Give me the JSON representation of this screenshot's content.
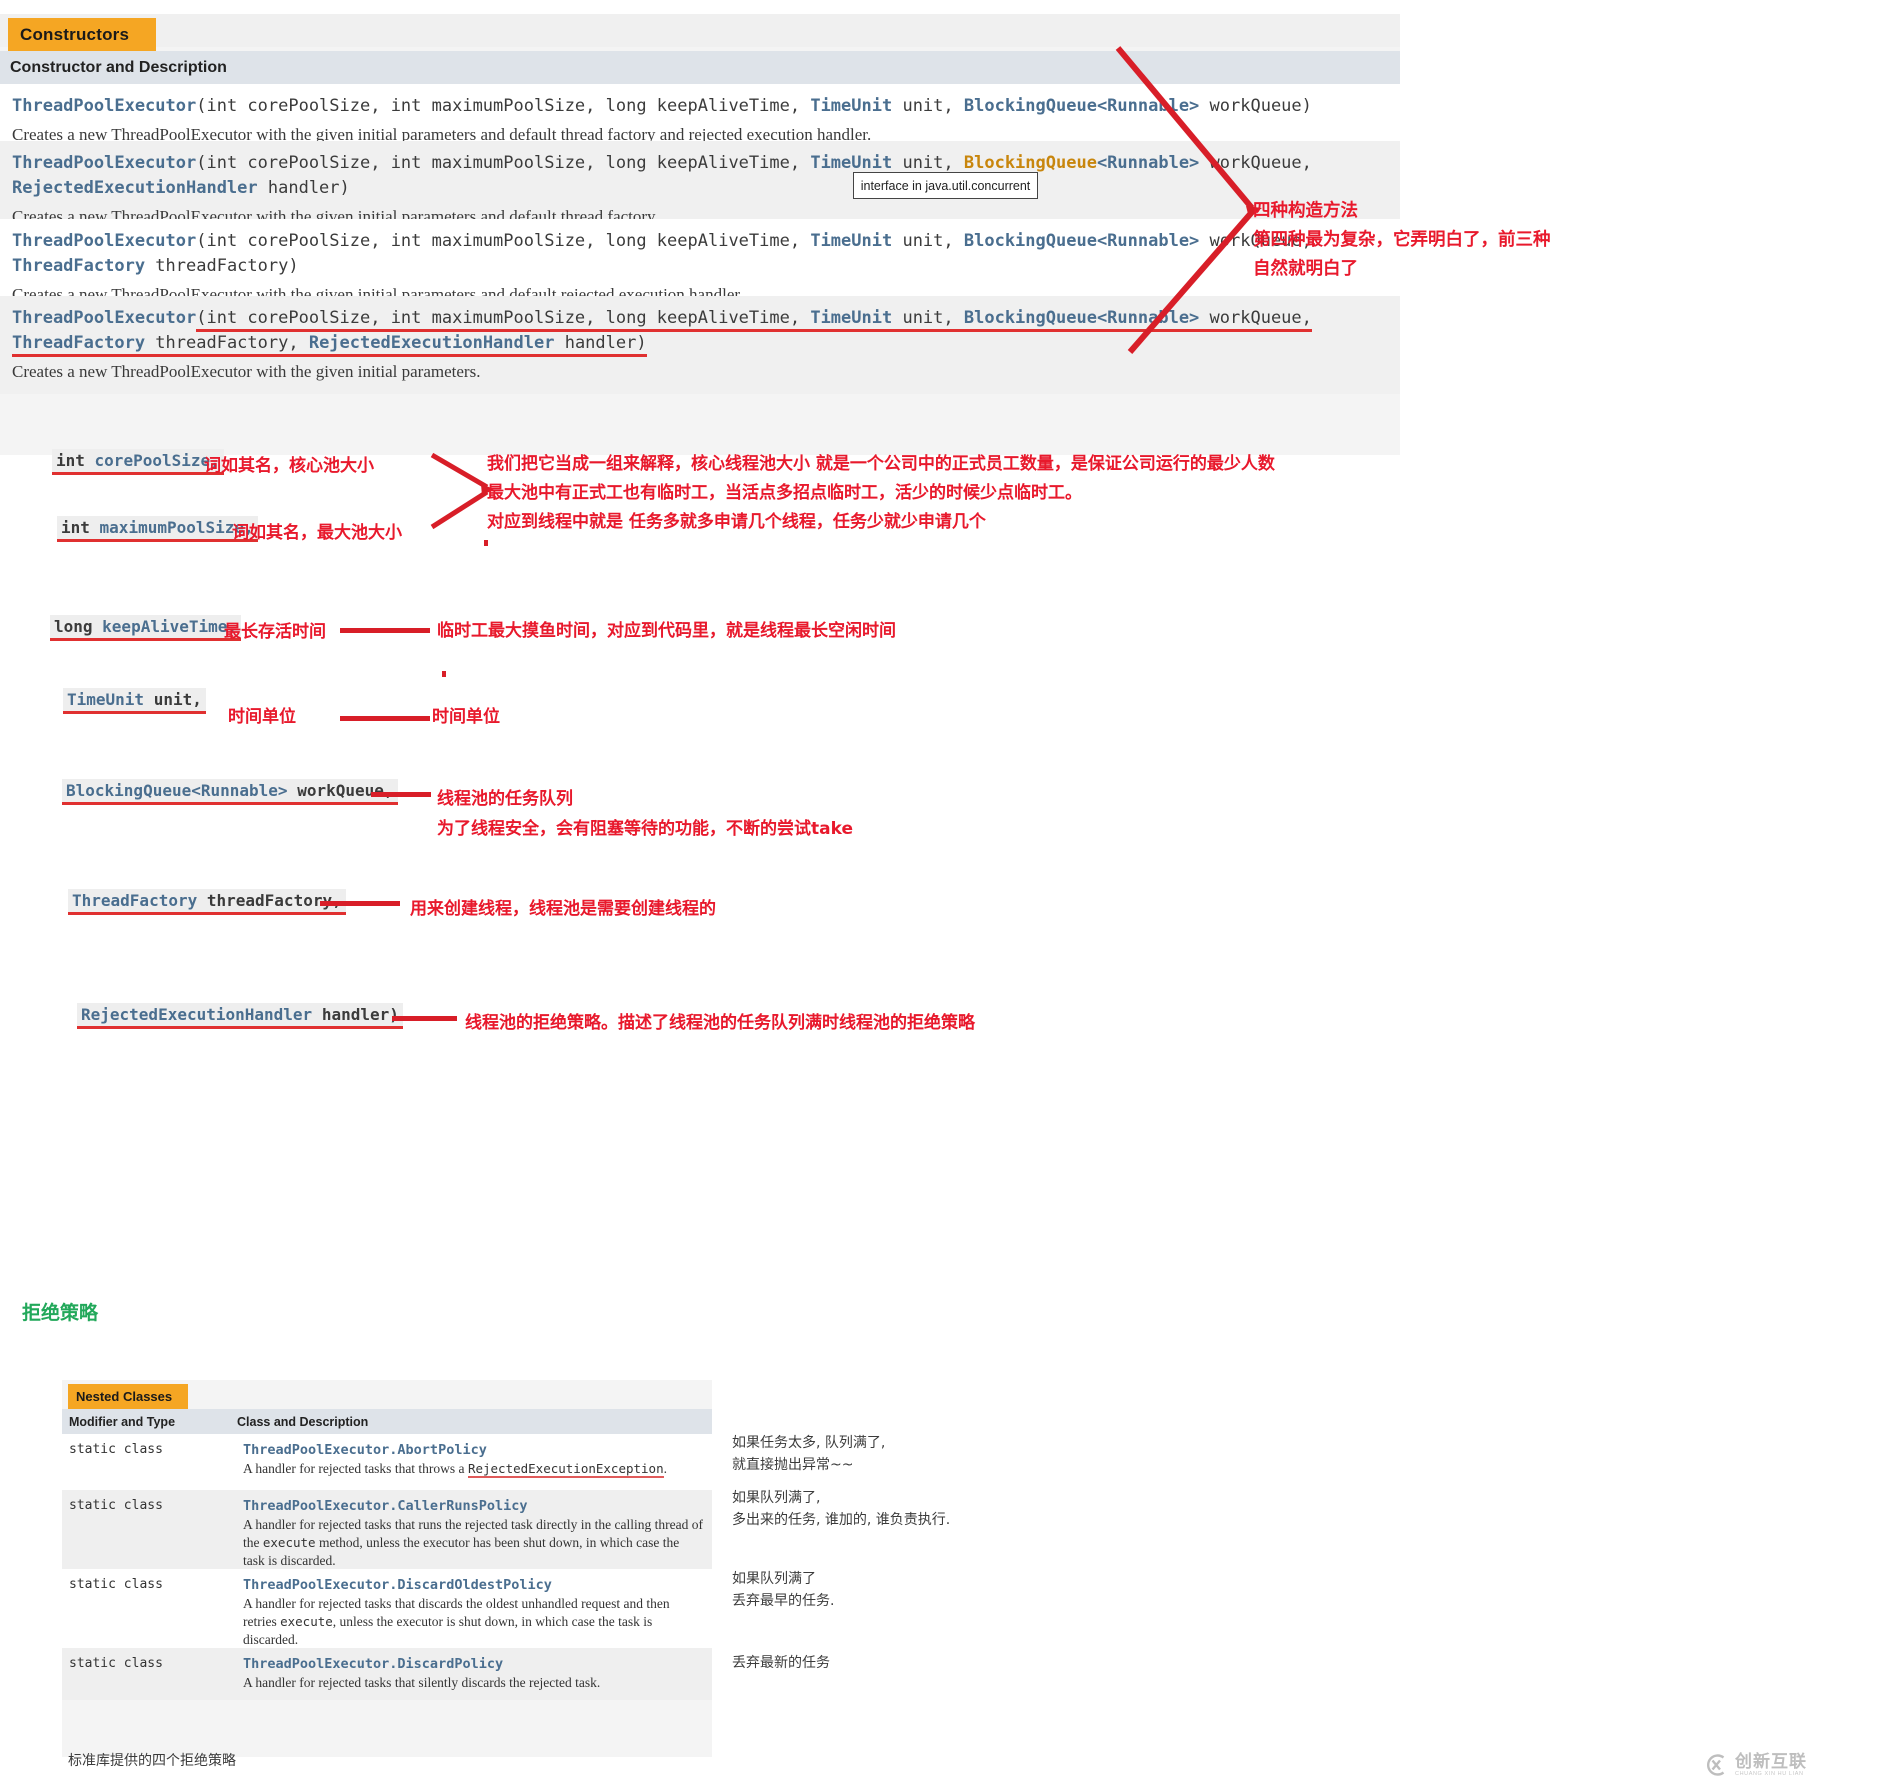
{
  "constructors_panel": {
    "tab_label": "Constructors",
    "column_header": "Constructor and Description",
    "tooltip": "interface in java.util.concurrent",
    "rows": [
      {
        "sig_line1_a": "ThreadPoolExecutor",
        "sig_line1_b": "(int corePoolSize, int maximumPoolSize, long keepAliveTime, ",
        "sig_line1_c": "TimeUnit",
        "sig_line1_d": " unit, ",
        "sig_line1_e": "BlockingQueue",
        "sig_line1_f": "<Runnable>",
        "sig_line1_g": " workQueue)",
        "sig_line2": "",
        "desc": "Creates a new ThreadPoolExecutor with the given initial parameters and default thread factory and rejected execution handler."
      },
      {
        "sig_line1_a": "ThreadPoolExecutor",
        "sig_line1_b": "(int corePoolSize, int maximumPoolSize, long keepAliveTime, ",
        "sig_line1_c": "TimeUnit",
        "sig_line1_d": " unit, ",
        "sig_line1_e": "BlockingQueue",
        "sig_line1_f": "<Runnable>",
        "sig_line1_g": " workQueue,",
        "sig_line2_a": "RejectedExecutionHandler",
        "sig_line2_b": " handler)",
        "desc": "Creates a new ThreadPoolExecutor with the given initial parameters and default thread factory."
      },
      {
        "sig_line1_a": "ThreadPoolExecutor",
        "sig_line1_b": "(int corePoolSize, int maximumPoolSize, long keepAliveTime, ",
        "sig_line1_c": "TimeUnit",
        "sig_line1_d": " unit, ",
        "sig_line1_e": "BlockingQueue",
        "sig_line1_f": "<Runnable>",
        "sig_line1_g": " workQueue,",
        "sig_line2_a": "ThreadFactory",
        "sig_line2_b": " threadFactory)",
        "desc": "Creates a new ThreadPoolExecutor with the given initial parameters and default rejected execution handler."
      },
      {
        "sig_line1_a": "ThreadPoolExecutor",
        "sig_line1_b": "(int corePoolSize, int maximumPoolSize, long keepAliveTime, ",
        "sig_line1_c": "TimeUnit",
        "sig_line1_d": " unit, ",
        "sig_line1_e": "BlockingQueue",
        "sig_line1_f": "<Runnable>",
        "sig_line1_g": " workQueue,",
        "sig_line2_a": "ThreadFactory",
        "sig_line2_b": " threadFactory, ",
        "sig_line2_c": "RejectedExecutionHandler",
        "sig_line2_d": " handler)",
        "desc": "Creates a new ThreadPoolExecutor with the given initial parameters."
      }
    ]
  },
  "top_note": {
    "line1": "四种构造方法",
    "line2": "第四种最为复杂，它弄明白了，前三种",
    "line3": "自然就明白了"
  },
  "params": [
    {
      "chip_type": "int",
      "chip_name": " corePoolSize,",
      "label": "词如其名，核心池大小"
    },
    {
      "chip_type": "int",
      "chip_name": " maximumPoolSize,",
      "label": "词如其名，最大池大小"
    },
    {
      "chip_type": "long",
      "chip_name": " keepAliveTime,",
      "label": "最长存活时间",
      "right": "临时工最大摸鱼时间，对应到代码里，就是线程最长空闲时间"
    },
    {
      "chip_type": "TimeUnit",
      "chip_name": " unit,",
      "label": "时间单位",
      "right": "时间单位"
    },
    {
      "chip_type": "BlockingQueue<Runnable>",
      "chip_name": " workQueue,",
      "right1": "线程池的任务队列",
      "right2": "为了线程安全，会有阻塞等待的功能，不断的尝试take"
    },
    {
      "chip_type": "ThreadFactory",
      "chip_name": " threadFactory,",
      "right": "用来创建线程，线程池是需要创建线程的"
    },
    {
      "chip_type": "RejectedExecutionHandler",
      "chip_name": " handler)",
      "right": "线程池的拒绝策略。描述了线程池的任务队列满时线程池的拒绝策略"
    }
  ],
  "pool_note": {
    "line1": "我们把它当成一组来解释，核心线程池大小 就是一个公司中的正式员工数量，是保证公司运行的最少人数",
    "line2": "最大池中有正式工也有临时工，当活点多招点临时工，活少的时候少点临时工。",
    "line3": "对应到线程中就是 任务多就多申请几个线程，任务少就少申请几个"
  },
  "reject_section": {
    "green_title": "拒绝策略",
    "bottom_note": "标准库提供的四个拒绝策略"
  },
  "nested_panel": {
    "tab_label": "Nested Classes",
    "col1_header": "Modifier and Type",
    "col2_header": "Class and Description",
    "rows": [
      {
        "modifier": "static class",
        "class_name": "ThreadPoolExecutor.AbortPolicy",
        "desc_pre": "A handler for rejected tasks that throws a ",
        "desc_link": "RejectedExecutionException",
        "desc_post": ".",
        "note1": "如果任务太多, 队列满了,",
        "note2": "就直接抛出异常~~"
      },
      {
        "modifier": "static class",
        "class_name": "ThreadPoolExecutor.CallerRunsPolicy",
        "desc_pre": "A handler for rejected tasks that runs the rejected task directly in the calling thread of the ",
        "desc_link": "execute",
        "desc_post": " method, unless the executor has been shut down, in which case the task is discarded.",
        "note1": "如果队列满了,",
        "note2": "多出来的任务, 谁加的, 谁负责执行."
      },
      {
        "modifier": "static class",
        "class_name": "ThreadPoolExecutor.DiscardOldestPolicy",
        "desc_pre": "A handler for rejected tasks that discards the oldest unhandled request and then retries ",
        "desc_link": "execute",
        "desc_post": ", unless the executor is shut down, in which case the task is discarded.",
        "note1": "如果队列满了",
        "note2": "丢弃最早的任务."
      },
      {
        "modifier": "static class",
        "class_name": "ThreadPoolExecutor.DiscardPolicy",
        "desc_pre": "A handler for rejected tasks that silently discards the rejected task.",
        "desc_link": "",
        "desc_post": "",
        "note1": "丢弃最新的任务",
        "note2": ""
      }
    ]
  },
  "watermark": {
    "main": "创新互联",
    "sub": "CHUANG XIN HU LIAN"
  },
  "colors": {
    "accent_orange": "#f5a623",
    "header_grey": "#dee3e9",
    "annotation_red": "#e8192c",
    "green": "#22a85a",
    "code_blue": "#4a6e8f"
  }
}
